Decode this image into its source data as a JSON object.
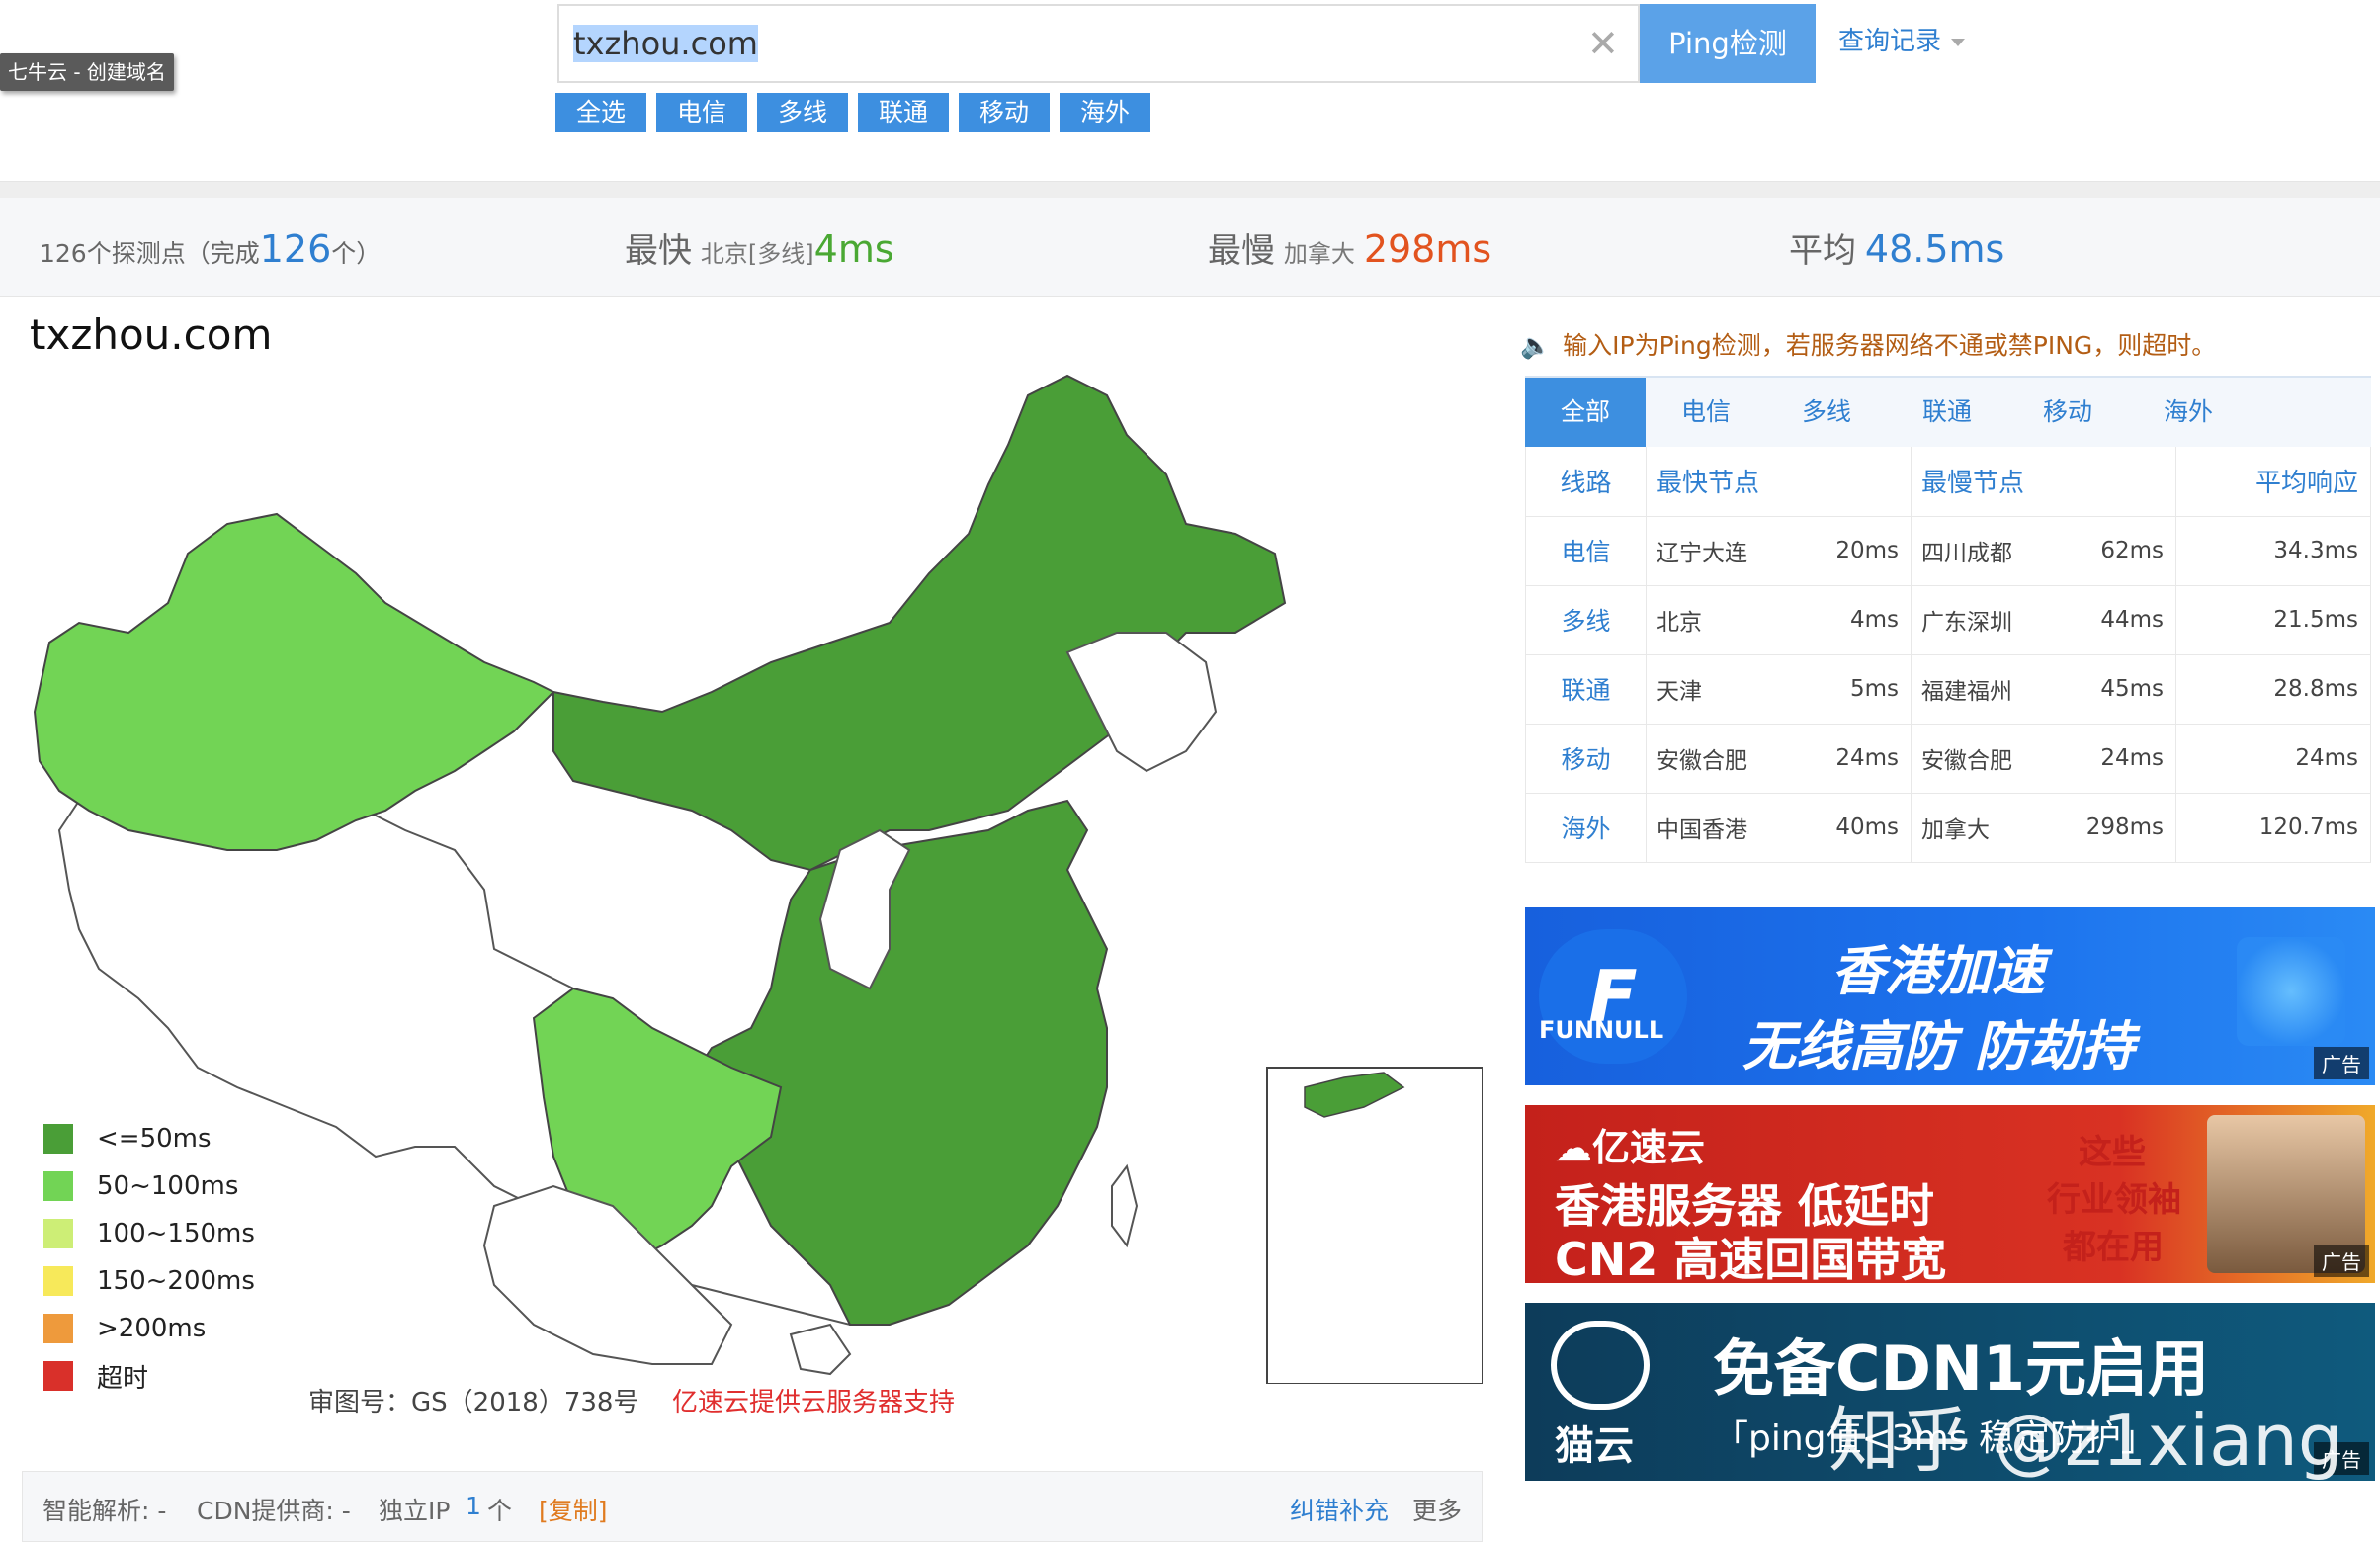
{
  "header": {
    "tag": "七牛云 - 创建域名",
    "search_value": "txzhou.com",
    "ping_button": "Ping检测",
    "history": "查询记录",
    "chips": [
      "全选",
      "电信",
      "多线",
      "联通",
      "移动",
      "海外"
    ]
  },
  "stats": {
    "nodes_label": "126个探测点（完成",
    "nodes_done": "126",
    "nodes_suffix": "个）",
    "fastest_label": "最快",
    "fastest_node": "北京[多线]",
    "fastest_value": "4ms",
    "slowest_label": "最慢",
    "slowest_node": "加拿大",
    "slowest_value": "298ms",
    "avg_label": "平均",
    "avg_value": "48.5ms"
  },
  "map": {
    "title": "txzhou.com",
    "approval": "审图号：GS（2018）738号",
    "sponsor": "亿速云提供云服务器支持",
    "legend": [
      {
        "label": "<=50ms",
        "color": "#4a9e37"
      },
      {
        "label": "50~100ms",
        "color": "#72d455"
      },
      {
        "label": "100~150ms",
        "color": "#cdee76"
      },
      {
        "label": "150~200ms",
        "color": "#f7e95a"
      },
      {
        "label": ">200ms",
        "color": "#ee9a3c"
      },
      {
        "label": "超时",
        "color": "#d9302a"
      }
    ]
  },
  "notice": "输入IP为Ping检测，若服务器网络不通或禁PING，则超时。",
  "tabs": [
    "全部",
    "电信",
    "多线",
    "联通",
    "移动",
    "海外"
  ],
  "table": {
    "headers": [
      "线路",
      "最快节点",
      "最慢节点",
      "平均响应"
    ],
    "rows": [
      {
        "line": "电信",
        "fast": "辽宁大连",
        "fast_ms": "20ms",
        "slow": "四川成都",
        "slow_ms": "62ms",
        "avg": "34.3ms"
      },
      {
        "line": "多线",
        "fast": "北京",
        "fast_ms": "4ms",
        "slow": "广东深圳",
        "slow_ms": "44ms",
        "avg": "21.5ms"
      },
      {
        "line": "联通",
        "fast": "天津",
        "fast_ms": "5ms",
        "slow": "福建福州",
        "slow_ms": "45ms",
        "avg": "28.8ms"
      },
      {
        "line": "移动",
        "fast": "安徽合肥",
        "fast_ms": "24ms",
        "slow": "安徽合肥",
        "slow_ms": "24ms",
        "avg": "24ms"
      },
      {
        "line": "海外",
        "fast": "中国香港",
        "fast_ms": "40ms",
        "slow": "加拿大",
        "slow_ms": "298ms",
        "avg": "120.7ms"
      }
    ]
  },
  "ads": {
    "ad1_brand": "FUNNULL",
    "ad1_line1": "香港加速",
    "ad1_line2": "无线高防 防劫持",
    "ad_tag": "广告",
    "ad2_brand": "亿速云",
    "ad2_line1": "香港服务器 低延时",
    "ad2_line2": "CN2 高速回国带宽",
    "ad2_right1": "这些",
    "ad2_right2": "行业领袖",
    "ad2_right3": "都在用",
    "ad3_brand": "猫云",
    "ad3_line1": "免备CDN1元启用",
    "ad3_line2": "「ping值<3ms 稳定防护」"
  },
  "bottom": {
    "resolve": "智能解析: -",
    "cdn": "CDN提供商: -",
    "ip_label": "独立IP",
    "ip_count": "1",
    "ip_unit": "个",
    "copy": "[复制]",
    "correct": "纠错补充",
    "more": "更多"
  },
  "watermark": "知乎 @z1xiang"
}
